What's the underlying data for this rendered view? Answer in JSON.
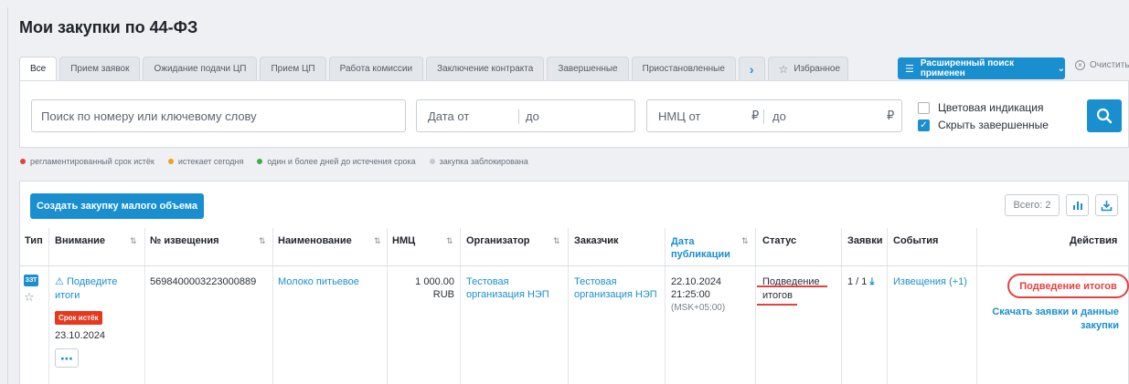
{
  "page_title": "Мои закупки по 44-ФЗ",
  "tabs": [
    {
      "label": "Все",
      "active": true
    },
    {
      "label": "Прием заявок"
    },
    {
      "label": "Ожидание подачи ЦП"
    },
    {
      "label": "Прием ЦП"
    },
    {
      "label": "Работа комиссии"
    },
    {
      "label": "Заключение контракта"
    },
    {
      "label": "Завершенные"
    },
    {
      "label": "Приостановленные"
    }
  ],
  "tab_next_icon": "chevron-right-icon",
  "favorites_tab": "Избранное",
  "advanced_search_label": "Расширенный поиск применен",
  "clear_label": "Очистить",
  "search": {
    "placeholder": "Поиск по номеру или ключевому слову"
  },
  "date": {
    "from": "Дата от",
    "to": "до"
  },
  "nmc": {
    "from": "НМЦ от",
    "to": "до",
    "currency": "₽"
  },
  "options": [
    {
      "label": "Цветовая индикация",
      "checked": false
    },
    {
      "label": "Скрыть завершенные",
      "checked": true
    }
  ],
  "legend": [
    {
      "label": "регламентированный срок истёк",
      "color": "#e34040"
    },
    {
      "label": "истекает сегодня",
      "color": "#f0a020"
    },
    {
      "label": "один и более дней до истечения срока",
      "color": "#3cb043"
    },
    {
      "label": "закупка заблокирована",
      "color": "#c5c9cf"
    }
  ],
  "create_button": "Создать закупку малого объема",
  "total_label": "Всего: 2",
  "columns": [
    "Тип",
    "Внимание",
    "№ извещения",
    "Наименование",
    "НМЦ",
    "Организатор",
    "Заказчик",
    "Дата публикации",
    "Статус",
    "Заявки",
    "События",
    "Действия"
  ],
  "row": {
    "type_badge": "ЗЗТ",
    "attention_line1": "Подведите",
    "attention_line2": "итоги",
    "deadline_badge": "Срок истёк",
    "deadline_date": "23.10.2024",
    "notice_number": "569840000322300088​9",
    "name": "Молоко питьевое",
    "nmc_value": "1 000.00",
    "nmc_currency": "RUB",
    "organizer_line1": "Тестовая",
    "organizer_line2": "организация НЭП",
    "customer_line1": "Тестовая",
    "customer_line2": "организация НЭП",
    "pub_date": "22.10.2024",
    "pub_time": "21:25:00",
    "pub_tz": "(MSK+05:00)",
    "status_line1": "Подведение",
    "status_line2": "итогов",
    "applications": "1 / 1",
    "events": "Извещения (+1)",
    "action_primary": "Подведение итогов",
    "action_secondary_line1": "Скачать заявки и данные",
    "action_secondary_line2": "закупки"
  },
  "colors": {
    "accent": "#1a8fd0",
    "danger": "#e34040"
  }
}
